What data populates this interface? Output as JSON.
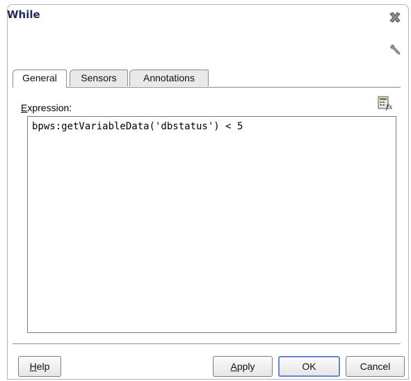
{
  "dialog": {
    "title": "While"
  },
  "tabs": [
    {
      "label": "General",
      "active": true
    },
    {
      "label": "Sensors",
      "active": false
    },
    {
      "label": "Annotations",
      "active": false
    }
  ],
  "general": {
    "expression_label_mnemonic": "E",
    "expression_label_rest": "xpression:",
    "expression_value": "bpws:getVariableData('dbstatus') < 5"
  },
  "buttons": {
    "help_mnemonic": "H",
    "help_rest": "elp",
    "apply_mnemonic": "A",
    "apply_rest": "pply",
    "ok": "OK",
    "cancel": "Cancel"
  },
  "icons": {
    "close": "close-x-icon",
    "settings": "wrench-icon",
    "expression_builder": "expression-builder-icon"
  },
  "colors": {
    "title": "#1c2a56",
    "default_button_border": "#6a86c8"
  }
}
